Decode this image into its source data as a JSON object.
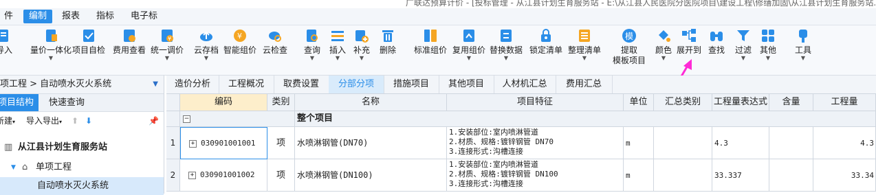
{
  "window": {
    "title_fragment": "广联达预算计价 - [投标管理 - 从江县计划生育服务站 - E:\\从江县人民医院分医院项目\\建设工程\\修缮加固\\从江县计划生育服务站.GBQ"
  },
  "menu": [
    "件",
    "编制",
    "报表",
    "指标",
    "电子标"
  ],
  "toolbar": [
    {
      "label": "导入",
      "name": "import"
    },
    {
      "label": "量价一体化",
      "name": "qty-price"
    },
    {
      "label": "项目自检",
      "name": "self-check"
    },
    {
      "label": "费用查看",
      "name": "fee-view"
    },
    {
      "label": "统一调价",
      "name": "unify-price"
    },
    {
      "label": "云存档",
      "name": "cloud-archive"
    },
    {
      "label": "智能组价",
      "name": "smart-price"
    },
    {
      "label": "云检查",
      "name": "cloud-check"
    },
    {
      "label": "查询",
      "name": "query"
    },
    {
      "label": "插入",
      "name": "insert"
    },
    {
      "label": "补充",
      "name": "supplement"
    },
    {
      "label": "删除",
      "name": "delete"
    },
    {
      "label": "标准组价",
      "name": "std-price"
    },
    {
      "label": "复用组价",
      "name": "reuse-price"
    },
    {
      "label": "替换数据",
      "name": "replace-data"
    },
    {
      "label": "锁定清单",
      "name": "lock-list"
    },
    {
      "label": "整理清单",
      "name": "sort-list"
    },
    {
      "label": "提取",
      "name": "extract"
    },
    {
      "label": "颜色",
      "name": "color"
    },
    {
      "label": "展开到",
      "name": "expand-to"
    },
    {
      "label": "查找",
      "name": "find"
    },
    {
      "label": "过滤",
      "name": "filter"
    },
    {
      "label": "其他",
      "name": "other"
    },
    {
      "label": "工具",
      "name": "tools"
    }
  ],
  "extract_sub": "模板项目",
  "extract_icon": "模",
  "left": {
    "breadcrumb": "项工程 > 自动喷水灭火系统",
    "tabs": [
      "项目结构",
      "快速查询"
    ],
    "new_label": "新建",
    "import_export": "导入导出",
    "tree": [
      "从江县计划生育服务站",
      "单项工程",
      "自动喷水灭火系统"
    ]
  },
  "tabs": [
    "造价分析",
    "工程概况",
    "取费设置",
    "分部分项",
    "措施项目",
    "其他项目",
    "人材机汇总",
    "费用汇总"
  ],
  "columns": [
    "编码",
    "类别",
    "名称",
    "项目特征",
    "单位",
    "汇总类别",
    "工程量表达式",
    "含量",
    "工程量"
  ],
  "group_row": "整个项目",
  "rows": [
    {
      "no": "1",
      "code": "030901001001",
      "type": "项",
      "name": "水喷淋钢管(DN70)",
      "features": [
        "1.安装部位:室内喷淋管道",
        "2.材质、规格:镀锌钢管 DN70",
        "3.连接形式:沟槽连接"
      ],
      "unit": "m",
      "expr": "4.3",
      "qty": "4.3"
    },
    {
      "no": "2",
      "code": "030901001002",
      "type": "项",
      "name": "水喷淋钢管(DN100)",
      "features": [
        "1.安装部位:室内喷淋管道",
        "2.材质、规格:镀锌钢管 DN100",
        "3.连接形式:沟槽连接"
      ],
      "unit": "m",
      "expr": "33.337",
      "qty": "33.34"
    }
  ],
  "colors": {
    "accent": "#2b8ee8",
    "arrow": "#ff2bd6",
    "selected_header": "#fdeecb"
  }
}
